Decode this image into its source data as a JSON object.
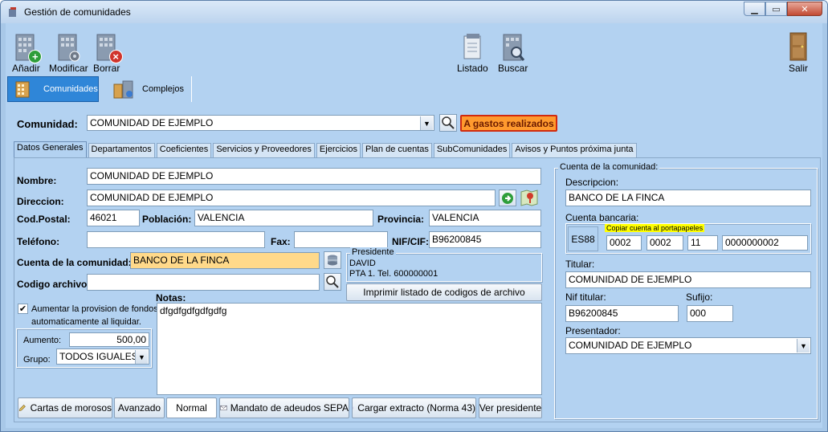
{
  "window": {
    "title": "Gestión de comunidades"
  },
  "toolbar": {
    "add": "Añadir",
    "modify": "Modificar",
    "delete": "Borrar",
    "list": "Listado",
    "search": "Buscar",
    "exit": "Salir"
  },
  "nav": {
    "tab1": "Comunidades",
    "tab2": "Complejos"
  },
  "community": {
    "label": "Comunidad:",
    "value": "COMUNIDAD DE EJEMPLO",
    "expenses_button": "A gastos realizados"
  },
  "tabs": [
    "Datos Generales",
    "Departamentos",
    "Coeficientes",
    "Servicios y Proveedores",
    "Ejercicios",
    "Plan de cuentas",
    "SubComunidades",
    "Avisos y Puntos próxima junta"
  ],
  "general": {
    "nombre_label": "Nombre:",
    "nombre": "COMUNIDAD DE EJEMPLO",
    "direccion_label": "Direccion:",
    "direccion": "COMUNIDAD DE EJEMPLO",
    "cp_label": "Cod.Postal:",
    "cp": "46021",
    "poblacion_label": "Población:",
    "poblacion": "VALENCIA",
    "provincia_label": "Provincia:",
    "provincia": "VALENCIA",
    "telefono_label": "Teléfono:",
    "telefono": "",
    "fax_label": "Fax:",
    "fax": "",
    "nif_label": "NIF/CIF:",
    "nif": "B96200845",
    "cuenta_label": "Cuenta de la comunidad:",
    "cuenta": "BANCO DE LA FINCA",
    "codigo_label": "Codigo archivo:",
    "codigo": "",
    "notas_label": "Notas:",
    "notas": "dfgdfgdfgdfgdfg"
  },
  "presidente": {
    "title": "Presidente",
    "name": "DAVID",
    "address": "PTA 1. Tel. 600000001",
    "print_button": "Imprimir listado de codigos de archivo"
  },
  "provision": {
    "checkbox_label_1": "Aumentar la provision de fondos",
    "checkbox_label_2": "automaticamente al liquidar.",
    "checked": true,
    "aumento_label": "Aumento:",
    "aumento": "500,00",
    "grupo_label": "Grupo:",
    "grupo": "TODOS IGUALES"
  },
  "bottom_buttons": {
    "cartas": "Cartas de morosos",
    "avanzado": "Avanzado",
    "normal": "Normal",
    "mandato": "Mandato de adeudos SEPA",
    "cargar": "Cargar extracto (Norma 43)",
    "ver": "Ver presidente"
  },
  "account": {
    "title": "Cuenta de la comunidad:",
    "descripcion_label": "Descripcion:",
    "descripcion": "BANCO DE LA FINCA",
    "bancaria_label": "Cuenta bancaria:",
    "copy_label": "Copiar cuenta al portapapeles",
    "iban": "ES88",
    "entidad": "0002",
    "oficina": "0002",
    "dc": "11",
    "numero": "0000000002",
    "titular_label": "Titular:",
    "titular": "COMUNIDAD DE EJEMPLO",
    "nif_titular_label": "Nif titular:",
    "nif_titular": "B96200845",
    "sufijo_label": "Sufijo:",
    "sufijo": "000",
    "presentador_label": "Presentador:",
    "presentador": "COMUNIDAD DE EJEMPLO"
  },
  "colors": {
    "accent_orange": "#ff9a2e",
    "highlight_field": "#ffd98a",
    "copy_badge": "#ffff00",
    "client_bg": "#b3d2f1"
  }
}
